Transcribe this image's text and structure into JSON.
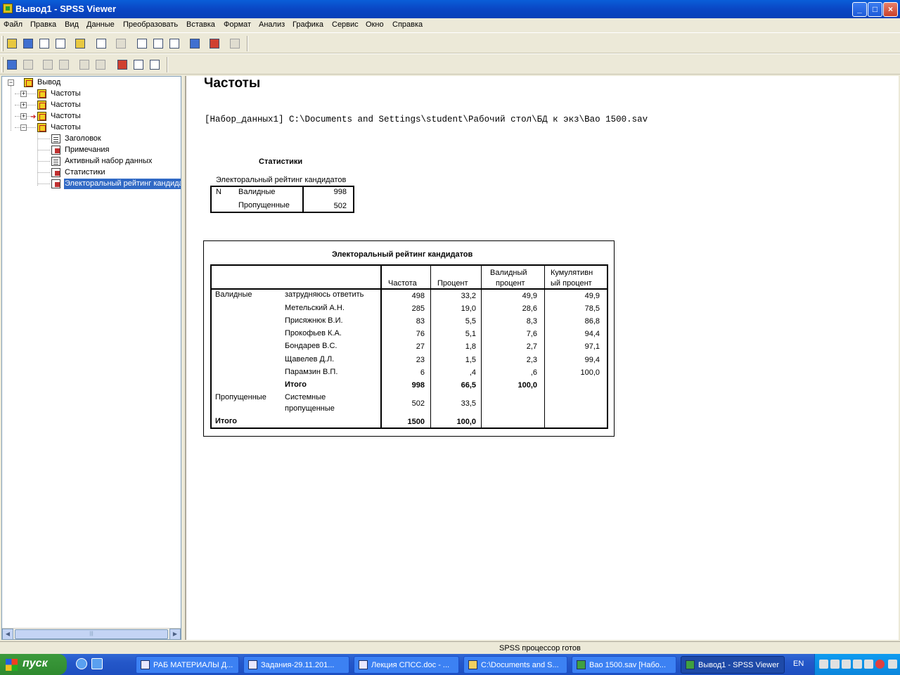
{
  "window": {
    "title": "Вывод1 - SPSS Viewer"
  },
  "menu": [
    "Файл",
    "Правка",
    "Вид",
    "Данные",
    "Преобразовать",
    "Вставка",
    "Формат",
    "Анализ",
    "Графика",
    "Сервис",
    "Окно",
    "Справка"
  ],
  "outline": {
    "root": "Вывод",
    "nodes": [
      "Частоты",
      "Частоты",
      "Частоты",
      "Частоты"
    ],
    "children": [
      "Заголовок",
      "Примечания",
      "Активный набор данных",
      "Статистики",
      "Электоральный рейтинг кандидатов"
    ]
  },
  "viewer": {
    "heading": "Частоты",
    "dataset_line": "[Набор_данных1] C:\\Documents and Settings\\student\\Рабочий стол\\БД к экз\\Вао 1500.sav",
    "stats": {
      "title": "Статистики",
      "subtitle": "Электоральный рейтинг кандидатов",
      "n": "N",
      "valid_label": "Валидные",
      "valid_value": "998",
      "missing_label": "Пропущенные",
      "missing_value": "502"
    },
    "freq": {
      "title": "Электоральный рейтинг кандидатов",
      "headers": {
        "freq": "Частота",
        "pct": "Процент",
        "valid1": "Валидный",
        "valid2": "процент",
        "cum1": "Кумулятивн",
        "cum2": "ый процент"
      },
      "valid_group": "Валидные",
      "rows": [
        {
          "label": "затрудняюсь ответить",
          "freq": "498",
          "pct": "33,2",
          "valid": "49,9",
          "cum": "49,9"
        },
        {
          "label": "Метельский А.Н.",
          "freq": "285",
          "pct": "19,0",
          "valid": "28,6",
          "cum": "78,5"
        },
        {
          "label": "Присяжнюк В.И.",
          "freq": "83",
          "pct": "5,5",
          "valid": "8,3",
          "cum": "86,8"
        },
        {
          "label": "Прокофьев К.А.",
          "freq": "76",
          "pct": "5,1",
          "valid": "7,6",
          "cum": "94,4"
        },
        {
          "label": "Бондарев В.С.",
          "freq": "27",
          "pct": "1,8",
          "valid": "2,7",
          "cum": "97,1"
        },
        {
          "label": "Щавелев Д.Л.",
          "freq": "23",
          "pct": "1,5",
          "valid": "2,3",
          "cum": "99,4"
        },
        {
          "label": "Парамзин В.П.",
          "freq": "6",
          "pct": ",4",
          "valid": ",6",
          "cum": "100,0"
        }
      ],
      "valid_total": {
        "label": "Итого",
        "freq": "998",
        "pct": "66,5",
        "valid": "100,0"
      },
      "missing_group": "Пропущенные",
      "missing_label1": "Системные",
      "missing_label2": "пропущенные",
      "missing": {
        "freq": "502",
        "pct": "33,5"
      },
      "total": {
        "label": "Итого",
        "freq": "1500",
        "pct": "100,0"
      }
    }
  },
  "status": "SPSS процессор готов",
  "taskbar": {
    "start": "пуск",
    "tasks": [
      "РАБ МАТЕРИАЛЫ Д...",
      "Задания-29.11.201...",
      "Лекция СПСС.doc - ...",
      "C:\\Documents and S...",
      "Вао 1500.sav [Набо...",
      "Вывод1 - SPSS Viewer"
    ],
    "lang": "EN"
  },
  "colors": {
    "titlebar": "#0a46c4",
    "selection": "#316ac5",
    "taskbar": "#2457c9",
    "start": "#2f8a2f"
  }
}
